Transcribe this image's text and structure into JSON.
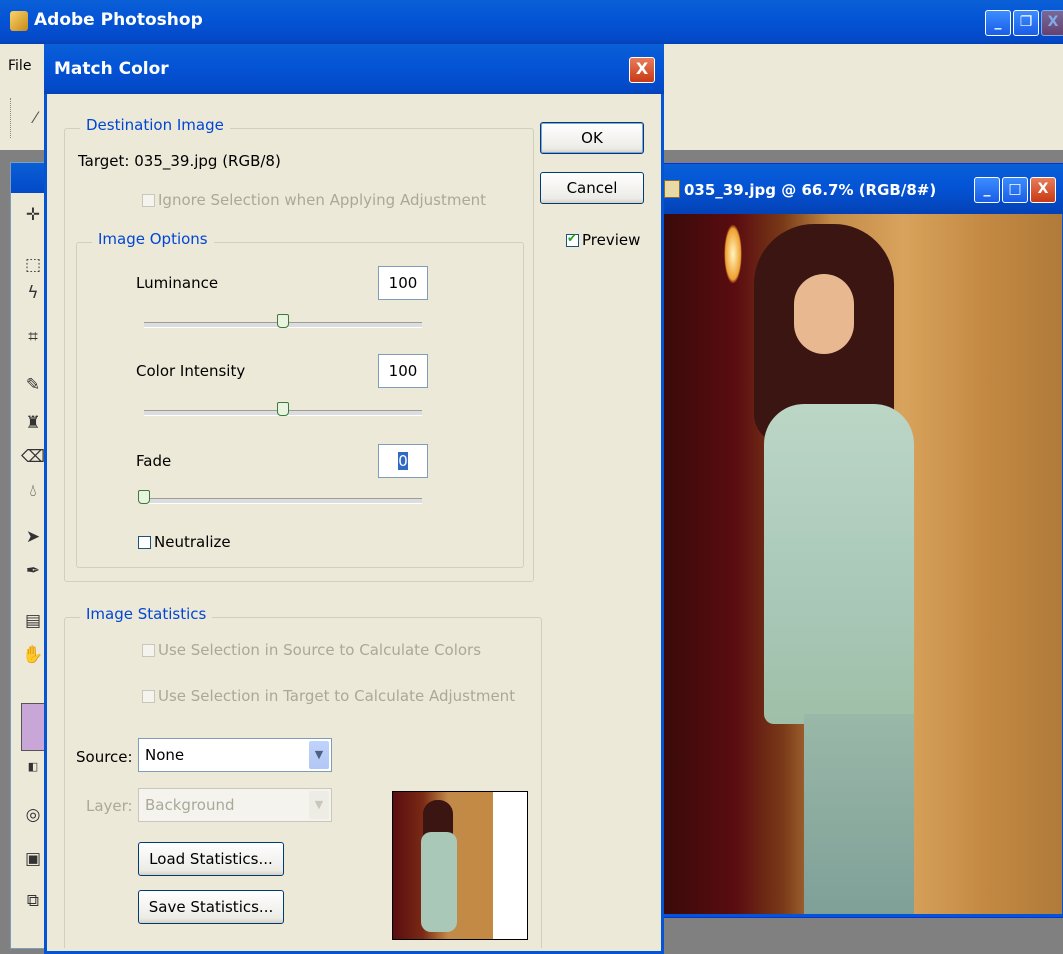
{
  "app": {
    "title": "Adobe Photoshop",
    "menu_file": "File"
  },
  "window_controls": {
    "minimize": "_",
    "restore": "❐",
    "close": "X"
  },
  "doc_window": {
    "title": "035_39.jpg @ 66.7% (RGB/8#)"
  },
  "dialog": {
    "title": "Match Color",
    "ok_label": "OK",
    "cancel_label": "Cancel",
    "preview_label": "Preview",
    "preview_checked": true,
    "destination": {
      "legend": "Destination Image",
      "target_text": "Target:  035_39.jpg (RGB/8)",
      "ignore_selection_label": "Ignore Selection when Applying Adjustment"
    },
    "image_options": {
      "legend": "Image Options",
      "luminance_label": "Luminance",
      "luminance_value": "100",
      "luminance_level": 0.5,
      "color_intensity_label": "Color Intensity",
      "color_intensity_value": "100",
      "color_intensity_level": 0.5,
      "fade_label": "Fade",
      "fade_value": "0",
      "fade_level": 0,
      "neutralize_label": "Neutralize"
    },
    "statistics": {
      "legend": "Image Statistics",
      "use_source_label": "Use Selection in Source to Calculate Colors",
      "use_target_label": "Use Selection in Target to Calculate Adjustment",
      "source_label": "Source:",
      "source_value": "None",
      "layer_label": "Layer:",
      "layer_value": "Background",
      "load_label": "Load Statistics...",
      "save_label": "Save Statistics..."
    }
  },
  "colors": {
    "title_bar": "#0454d6",
    "dialog_bg": "#ece9d8",
    "legend_text": "#0046d5",
    "foreground_swatch": "#c8a6d8"
  }
}
